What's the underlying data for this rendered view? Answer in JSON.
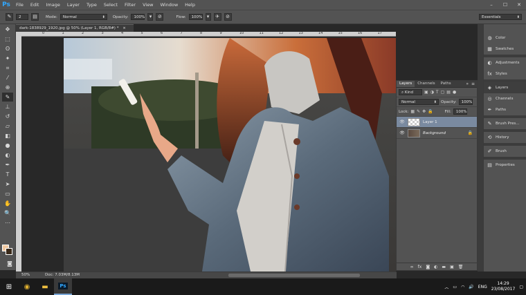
{
  "app": {
    "logo": "Ps"
  },
  "menu": [
    "File",
    "Edit",
    "Image",
    "Layer",
    "Type",
    "Select",
    "Filter",
    "View",
    "Window",
    "Help"
  ],
  "window_controls": {
    "minimize": "–",
    "maximize": "☐",
    "close": "✕"
  },
  "options": {
    "brush_size": "2",
    "mode_label": "Mode:",
    "mode_value": "Normal",
    "opacity_label": "Opacity:",
    "opacity_value": "100%",
    "flow_label": "Flow:",
    "flow_value": "100%",
    "workspace": "Essentials"
  },
  "document": {
    "tab_title": "dark-1838929_1920.jpg @ 50% (Layer 1, RGB/8#) *",
    "ruler_marks": [
      "0",
      "1",
      "2",
      "3",
      "4",
      "5",
      "6",
      "7",
      "8",
      "9",
      "10",
      "11",
      "12",
      "13",
      "14",
      "15",
      "16",
      "17"
    ],
    "zoom": "50%",
    "doc_size": "Doc: 7.03M/8.13M"
  },
  "layers_panel": {
    "tabs": [
      "Layers",
      "Channels",
      "Paths"
    ],
    "filter_label": "Kind",
    "blend_mode": "Normal",
    "opacity_label": "Opacity:",
    "opacity_value": "100%",
    "lock_label": "Lock:",
    "fill_label": "Fill:",
    "fill_value": "100%",
    "layers": [
      {
        "name": "Layer 1",
        "selected": true
      },
      {
        "name": "Background",
        "selected": false
      }
    ]
  },
  "right_panels": [
    {
      "label": "Color",
      "icon": "color-wheel-icon"
    },
    {
      "label": "Swatches",
      "icon": "swatches-grid-icon"
    },
    {
      "label": "Adjustments",
      "icon": "adjustments-icon"
    },
    {
      "label": "Styles",
      "icon": "styles-icon"
    },
    {
      "label": "Layers",
      "icon": "layers-icon"
    },
    {
      "label": "Channels",
      "icon": "channels-icon"
    },
    {
      "label": "Paths",
      "icon": "paths-icon"
    },
    {
      "label": "Brush Pres...",
      "icon": "brush-presets-icon"
    },
    {
      "label": "History",
      "icon": "history-icon"
    },
    {
      "label": "Brush",
      "icon": "brush-icon"
    },
    {
      "label": "Properties",
      "icon": "properties-icon"
    }
  ],
  "colors": {
    "foreground": "#f0c8a0",
    "background": "#3a2a1a",
    "accent": "#31a8ff"
  },
  "taskbar": {
    "language": "ENG",
    "time": "14:29",
    "date": "23/08/2017"
  }
}
